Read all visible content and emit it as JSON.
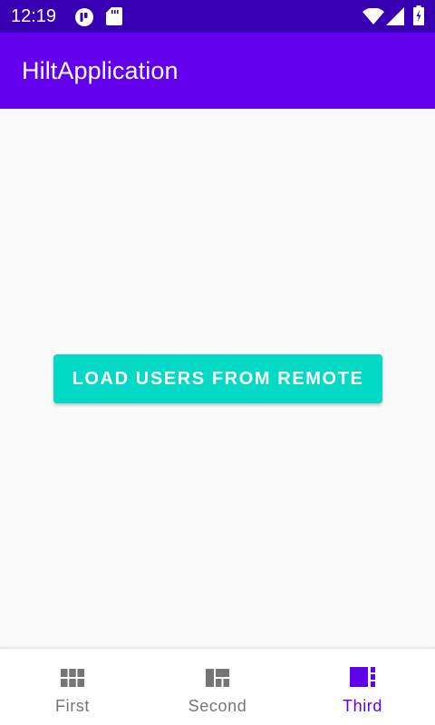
{
  "status_bar": {
    "time": "12:19",
    "icons": [
      "app-notification-icon",
      "sd-card-icon",
      "wifi-icon",
      "cell-signal-icon",
      "battery-icon"
    ]
  },
  "app_bar": {
    "title": "HiltApplication"
  },
  "main": {
    "load_button_label": "LOAD USERS FROM REMOTE"
  },
  "bottom_nav": {
    "items": [
      {
        "label": "First",
        "icon": "grid-icon",
        "active": false
      },
      {
        "label": "Second",
        "icon": "dashboard-icon",
        "active": false
      },
      {
        "label": "Third",
        "icon": "quilt-icon",
        "active": true
      }
    ]
  },
  "colors": {
    "status_bar": "#3700b3",
    "primary": "#6200ee",
    "secondary": "#03dac5",
    "background": "#fafafa",
    "nav_inactive": "#757575"
  }
}
